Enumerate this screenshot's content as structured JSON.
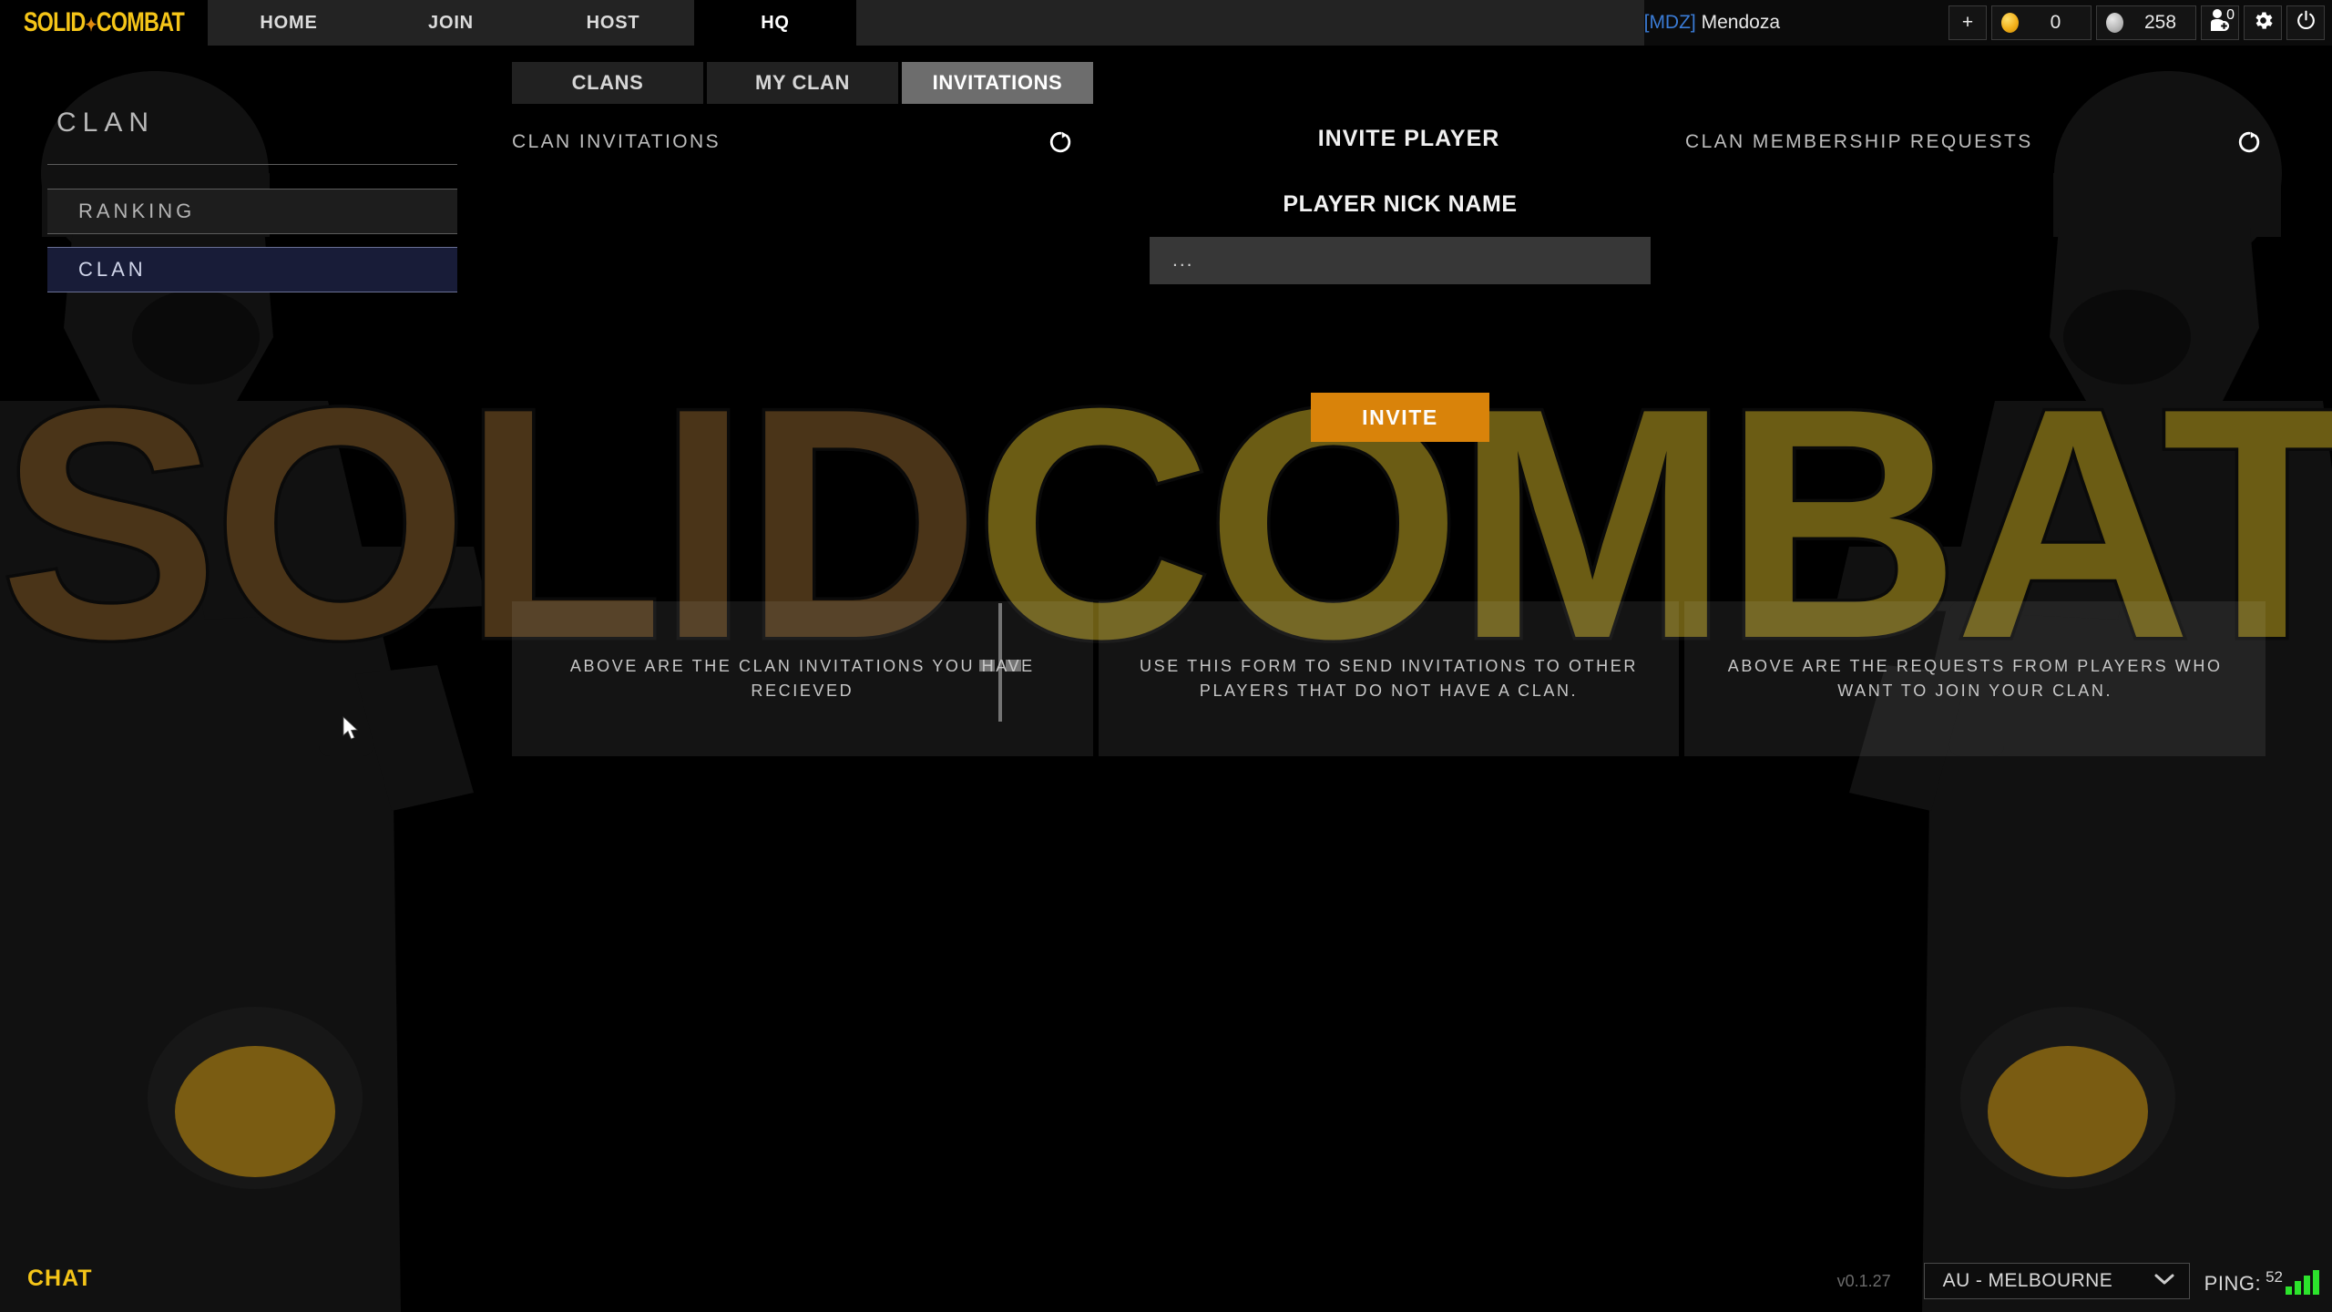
{
  "app": {
    "logo_text": "SOLID",
    "logo_text2": "COMBAT",
    "logo_dot": "✦"
  },
  "topnav": {
    "items": [
      {
        "label": "HOME",
        "active": false
      },
      {
        "label": "JOIN",
        "active": false
      },
      {
        "label": "HOST",
        "active": false
      },
      {
        "label": "HQ",
        "active": true
      }
    ]
  },
  "player": {
    "clan_tag": "[MDZ]",
    "name": "Mendoza",
    "add_label": "+",
    "gold_amount": "0",
    "silver_amount": "258",
    "friend_requests_badge": "0",
    "gold_color": "#f2b01a",
    "silver_color": "#b9b9b9"
  },
  "subtabs": {
    "items": [
      {
        "label": "CLANS",
        "active": false
      },
      {
        "label": "MY CLAN",
        "active": false
      },
      {
        "label": "INVITATIONS",
        "active": true
      }
    ]
  },
  "sidebar": {
    "title": "CLAN",
    "items": [
      {
        "label": "RANKING",
        "active": false
      },
      {
        "label": "CLAN",
        "active": true
      }
    ]
  },
  "columns": {
    "left_header": "CLAN INVITATIONS",
    "center_header": "INVITE PLAYER",
    "right_header": "CLAN MEMBERSHIP REQUESTS"
  },
  "invite_form": {
    "nick_label": "PLAYER NICK NAME",
    "nick_value": "...",
    "nick_placeholder": "...",
    "invite_button": "INVITE",
    "button_color": "#d9830a"
  },
  "help": {
    "left": "ABOVE ARE THE CLAN INVITATIONS YOU HAVE RECIEVED",
    "center": "USE THIS FORM TO SEND INVITATIONS TO OTHER PLAYERS THAT DO NOT HAVE A CLAN.",
    "right": "ABOVE ARE THE REQUESTS FROM PLAYERS WHO WANT TO JOIN YOUR CLAN."
  },
  "footer": {
    "chat_label": "CHAT",
    "version": "v0.1.27",
    "server": "AU - MELBOURNE",
    "ping_label": "PING:",
    "ping_value": "52",
    "ping_color": "#2ce32c"
  },
  "watermark": {
    "left_word": "SOLID",
    "right_word": "COMBAT",
    "left_color": "#4a3418",
    "right_color": "#6b5c14"
  }
}
